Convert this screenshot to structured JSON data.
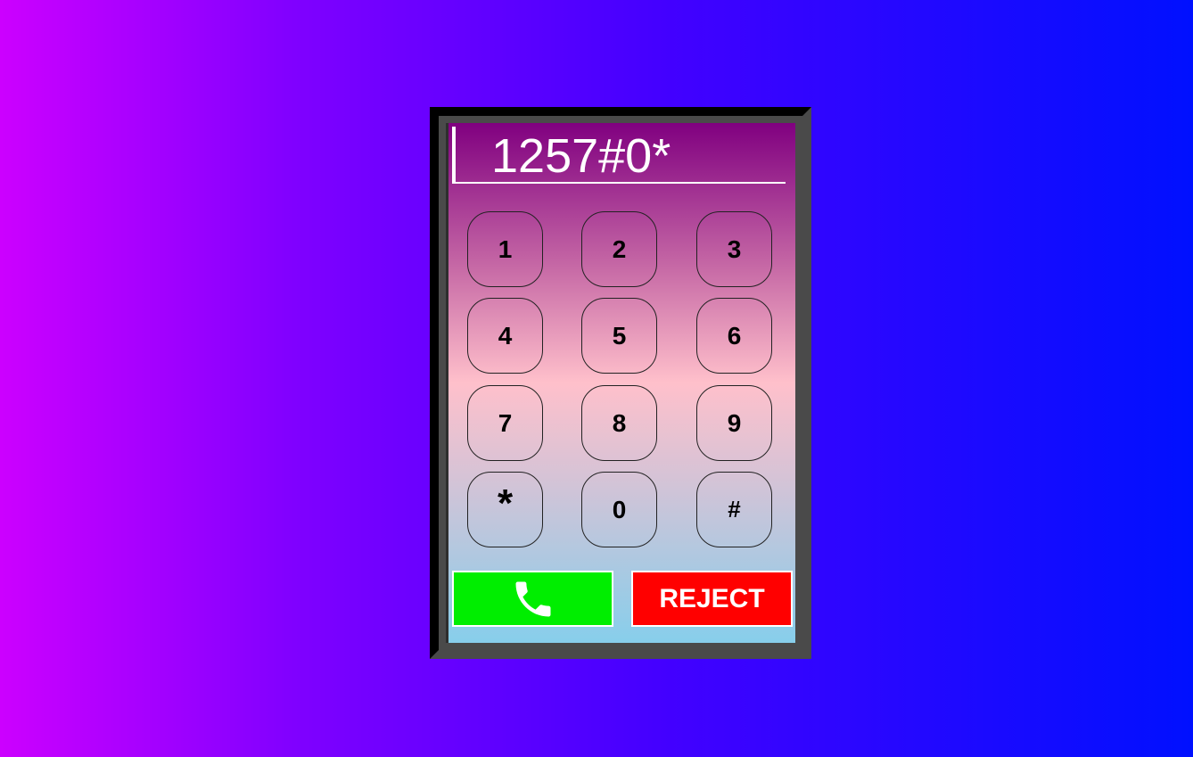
{
  "display": {
    "value": "1257#0*"
  },
  "keypad": {
    "keys": [
      "1",
      "2",
      "3",
      "4",
      "5",
      "6",
      "7",
      "8",
      "9",
      "*",
      "0",
      "#"
    ]
  },
  "actions": {
    "call_icon": "phone-icon",
    "reject_label": "REJECT"
  },
  "colors": {
    "call": "#00ee00",
    "reject": "#ff0000",
    "display_text": "#ffffff"
  }
}
